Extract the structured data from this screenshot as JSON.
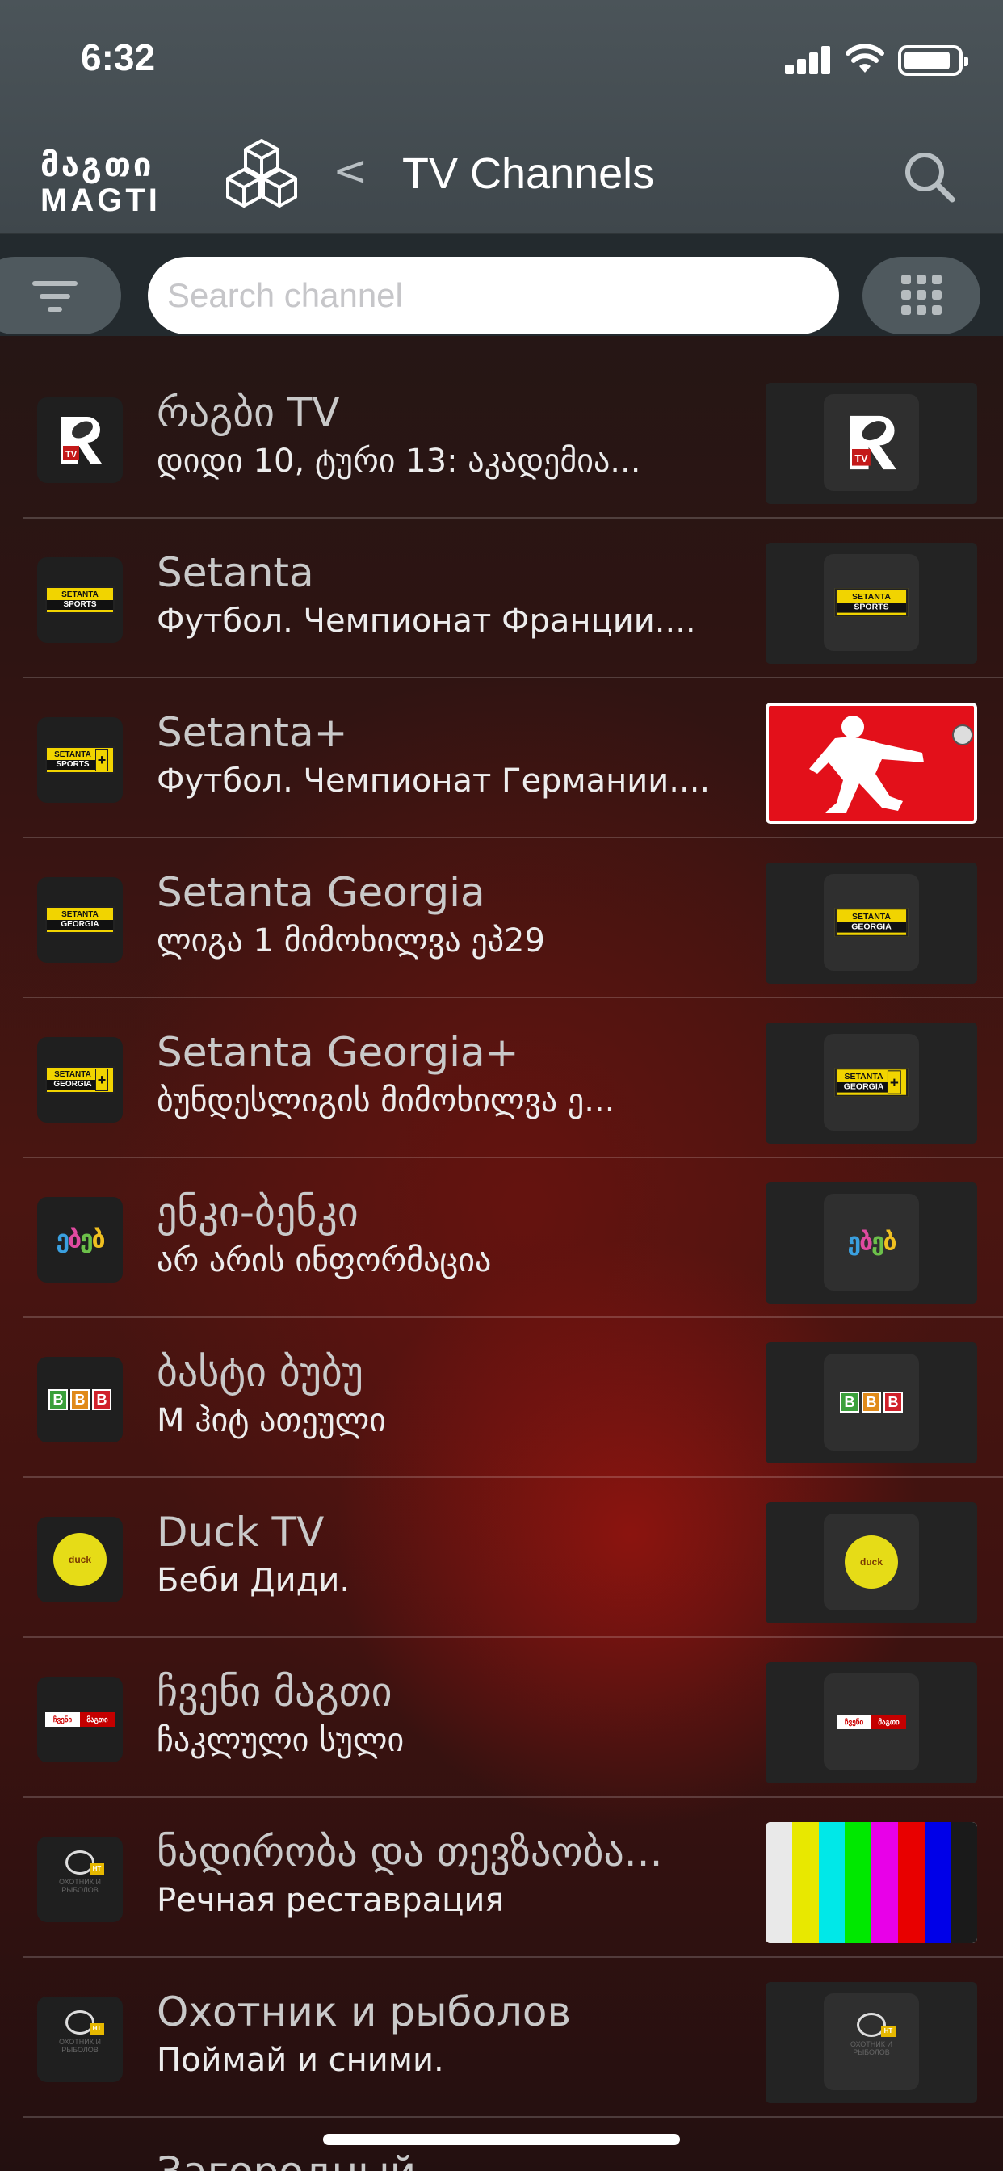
{
  "status_bar": {
    "time": "6:32"
  },
  "header": {
    "logo_georgian": "მაგთი",
    "logo_latin": "MAGTI",
    "back_label": "<",
    "title": "TV Channels"
  },
  "search": {
    "placeholder": "Search channel"
  },
  "channels": [
    {
      "name": "რაგბი TV",
      "program": "დიდი 10, ტური 13: აკადემია...",
      "logo": "rugby-tv-logo"
    },
    {
      "name": "Setanta",
      "program": "Футбол. Чемпионат Франции....",
      "logo": "setanta-sports-logo"
    },
    {
      "name": "Setanta+",
      "program": "Футбол. Чемпионат Германии....",
      "logo": "setanta-sports-plus-logo"
    },
    {
      "name": "Setanta Georgia",
      "program": "ლიგა 1 მიმოხილვა ეპ29",
      "logo": "setanta-georgia-logo"
    },
    {
      "name": "Setanta Georgia+",
      "program": "ბუნდესლიგის მიმოხილვა ე...",
      "logo": "setanta-georgia-plus-logo"
    },
    {
      "name": "ენკი-ბენკი",
      "program": "არ არის ინფორმაცია",
      "logo": "enki-benki-logo"
    },
    {
      "name": "ბასტი ბუბუ",
      "program": "M ჰიტ ათეული",
      "logo": "basti-bubu-logo"
    },
    {
      "name": "Duck TV",
      "program": "Беби Диди.",
      "logo": "duck-tv-logo"
    },
    {
      "name": "ჩვენი მაგთი",
      "program": "ჩაკლული სული",
      "logo": "chveni-magti-logo"
    },
    {
      "name": "ნადირობა და თევზაობა...",
      "program": "Речная реставрация",
      "logo": "hunter-fisher-logo"
    },
    {
      "name": "Охотник и рыболов",
      "program": "Поймай и сними.",
      "logo": "hunter-fisher-logo"
    }
  ],
  "partial_channel_name": "Загородный",
  "logo_text": {
    "setanta": "SETANTA",
    "sports": "SPORTS",
    "georgia": "GEORGIA",
    "plus": "+",
    "bbb": [
      "B",
      "B",
      "B"
    ],
    "duck": "duck",
    "chveni_a": "ჩვენი",
    "chveni_b": "მაგთი",
    "enki": [
      "ე",
      "ბ",
      "ე",
      "ბ"
    ],
    "hunter_tag": "HT",
    "hunter_txt": "ОХОТНИК И РЫБОЛОВ",
    "rugby_tag": "TV"
  },
  "colors": {
    "header_bg": "#4b5459",
    "search_row_bg": "#232a2e",
    "setanta_yellow": "#f1d400",
    "football_red": "#e3101a"
  },
  "test_card_colors": [
    "#e9e9e9",
    "#e8e800",
    "#00e8e8",
    "#00e800",
    "#e800e8",
    "#e80000",
    "#0000e8",
    "#1a1a1a"
  ]
}
